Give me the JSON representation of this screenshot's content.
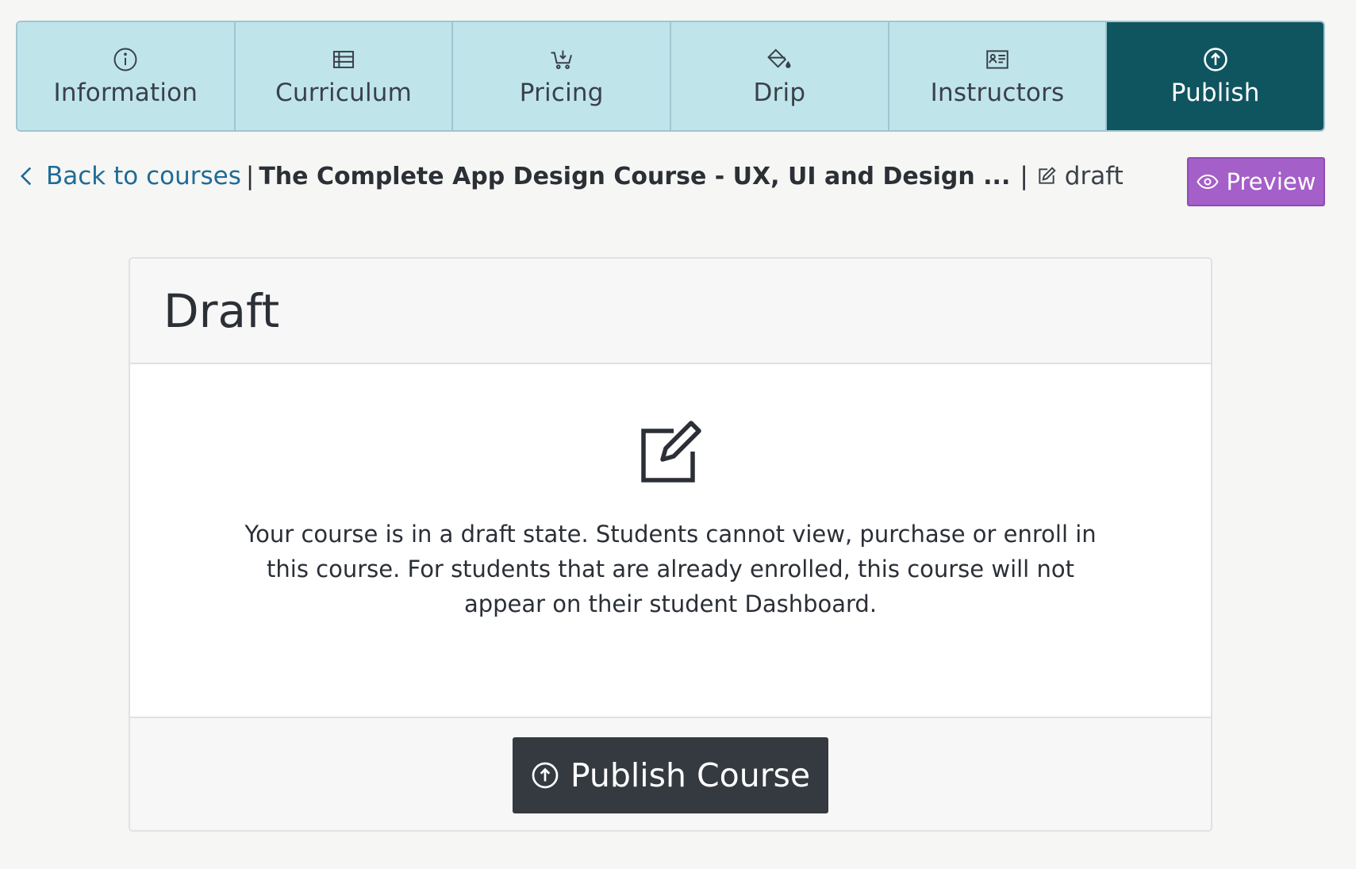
{
  "tabs": [
    {
      "label": "Information",
      "icon": "info-circle-icon",
      "active": false
    },
    {
      "label": "Curriculum",
      "icon": "table-list-icon",
      "active": false
    },
    {
      "label": "Pricing",
      "icon": "cart-icon",
      "active": false
    },
    {
      "label": "Drip",
      "icon": "paint-bucket-icon",
      "active": false
    },
    {
      "label": "Instructors",
      "icon": "id-card-icon",
      "active": false
    },
    {
      "label": "Publish",
      "icon": "upload-circle-icon",
      "active": true
    }
  ],
  "breadcrumb": {
    "back_label": "Back to courses",
    "separator": "|",
    "course_title": "The Complete App Design Course - UX, UI and Design ...",
    "status": "draft"
  },
  "preview": {
    "label": "Preview"
  },
  "card": {
    "title": "Draft",
    "message": "Your course is in a draft state. Students cannot view, purchase or enroll in this course. For students that are already enrolled, this course will not appear on their student Dashboard.",
    "publish_label": "Publish Course"
  },
  "colors": {
    "tab_bg": "#bfe5eb",
    "tab_active_bg": "#0f5560",
    "link": "#1f6b97",
    "preview_bg": "#a45fc8",
    "publish_bg": "#343a40"
  }
}
